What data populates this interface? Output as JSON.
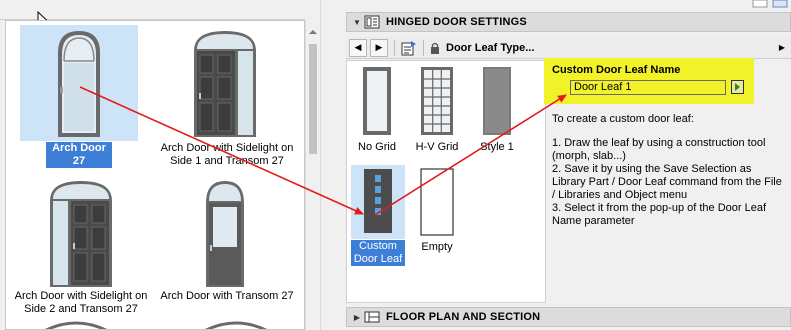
{
  "library": {
    "items": [
      {
        "label": "Arch Door 27",
        "selected": true
      },
      {
        "label": "Arch Door with Sidelight on Side 1 and Transom 27",
        "selected": false
      },
      {
        "label": "Arch Door with Sidelight on Side 2 and Transom 27",
        "selected": false
      },
      {
        "label": "Arch Door with Transom 27",
        "selected": false
      }
    ]
  },
  "settings": {
    "section_title": "HINGED DOOR SETTINGS",
    "toolbar_dropdown": "Door Leaf Type...",
    "leaf_types": [
      {
        "label": "No Grid"
      },
      {
        "label": "H-V Grid"
      },
      {
        "label": "Style 1"
      },
      {
        "label": "Custom Door Leaf",
        "selected": true
      },
      {
        "label": "Empty"
      }
    ],
    "custom_name_label": "Custom Door Leaf Name",
    "custom_name_value": "Door Leaf 1",
    "help_intro": "To create a custom door leaf:",
    "help_steps": [
      "1. Draw the leaf by using a construction tool (morph, slab...)",
      "2. Save it by using the Save Selection as Library Part / Door Leaf command from the File / Libraries and Object menu",
      "3. Select it from the pop-up of the Door Leaf Name parameter"
    ],
    "next_section_title": "FLOOR PLAN AND SECTION"
  },
  "colors": {
    "highlight_yellow": "#f2f22a",
    "selection_blue": "#3d7fd6",
    "selection_fill": "#cce3f8",
    "annotation_arrow": "#e31b1b"
  },
  "icons": [
    "cursor-arrow-icon",
    "scroll-up-icon",
    "expand-triangle-icon",
    "door-settings-icon",
    "prev-icon",
    "next-icon",
    "favorites-icon",
    "lock-icon",
    "go-icon",
    "floor-plan-icon"
  ]
}
